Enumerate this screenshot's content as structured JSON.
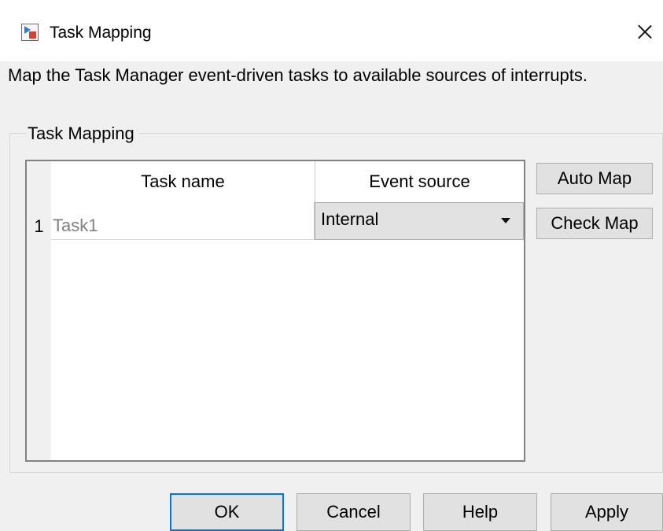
{
  "window": {
    "title": "Task Mapping",
    "close_glyph": "×"
  },
  "description": "Map the Task Manager event-driven tasks to available sources of interrupts.",
  "group": {
    "legend": "Task Mapping"
  },
  "table": {
    "columns": [
      "Task name",
      "Event source"
    ],
    "rows": [
      {
        "num": "1",
        "task_name": "Task1",
        "event_source": "Internal"
      }
    ]
  },
  "side_buttons": {
    "auto_map": "Auto Map",
    "check_map": "Check Map"
  },
  "footer_buttons": {
    "ok": "OK",
    "cancel": "Cancel",
    "help": "Help",
    "apply": "Apply"
  },
  "icons": {
    "app": "simulink-model-icon",
    "close": "close-icon",
    "dropdown": "chevron-down-icon"
  },
  "colors": {
    "focus_border": "#0078d7",
    "dialog_bg": "#f0f0f0",
    "task_text": "#808080"
  }
}
